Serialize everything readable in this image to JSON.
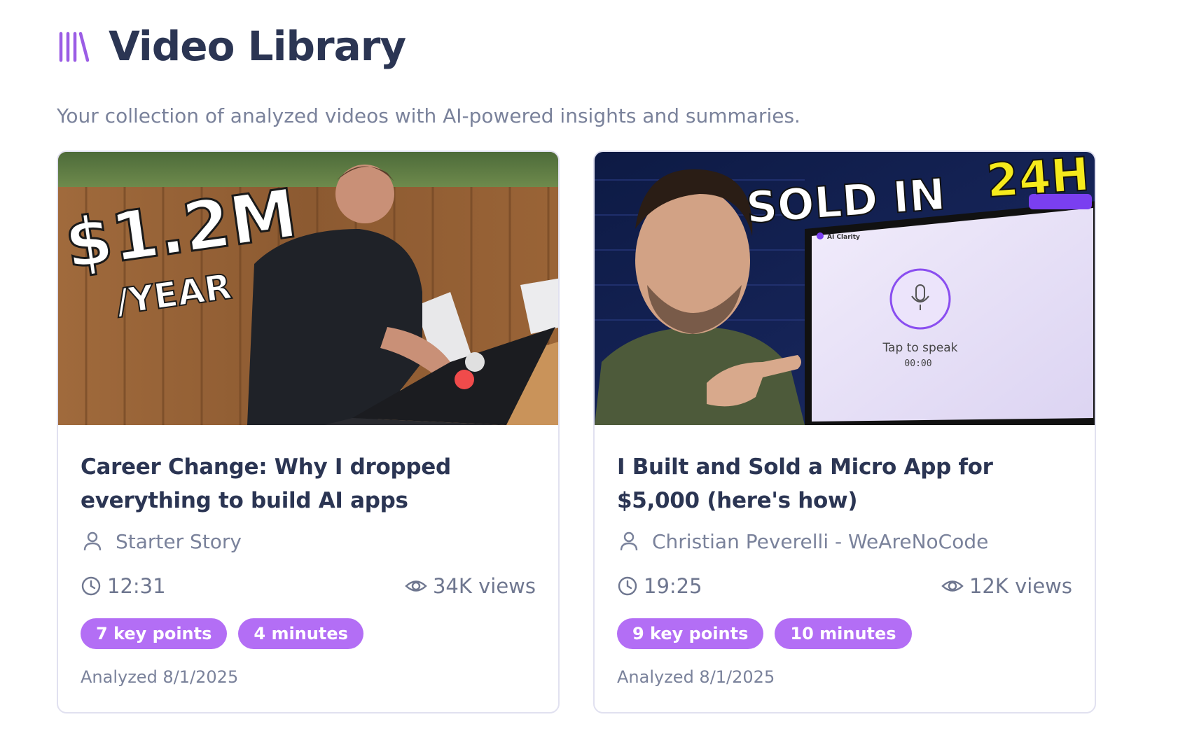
{
  "header": {
    "title": "Video Library",
    "icon": "library-icon",
    "subtitle": "Your collection of analyzed videos with AI-powered insights and summaries."
  },
  "colors": {
    "accent": "#b36ef5",
    "title": "#2b3553",
    "muted": "#7a829b",
    "card_border": "#e1e1f0"
  },
  "videos": [
    {
      "title": "Career Change: Why I dropped everything to build AI apps",
      "channel": "Starter Story",
      "duration": "12:31",
      "views": "34K views",
      "tags": [
        "7 key points",
        "4 minutes"
      ],
      "analyzed": "Analyzed 8/1/2025",
      "thumbnail": {
        "text_main": "$1.2M",
        "text_sub": "/YEAR"
      }
    },
    {
      "title": "I Built and Sold a Micro App for $5,000 (here's how)",
      "channel": "Christian Peverelli - WeAreNoCode",
      "duration": "19:25",
      "views": "12K views",
      "tags": [
        "9 key points",
        "10 minutes"
      ],
      "analyzed": "Analyzed 8/1/2025",
      "thumbnail": {
        "text_main": "SOLD IN",
        "text_accent": "24H",
        "screen_brand": "AI Clarity",
        "screen_caption": "Tap to speak",
        "screen_timer": "00:00"
      }
    }
  ]
}
